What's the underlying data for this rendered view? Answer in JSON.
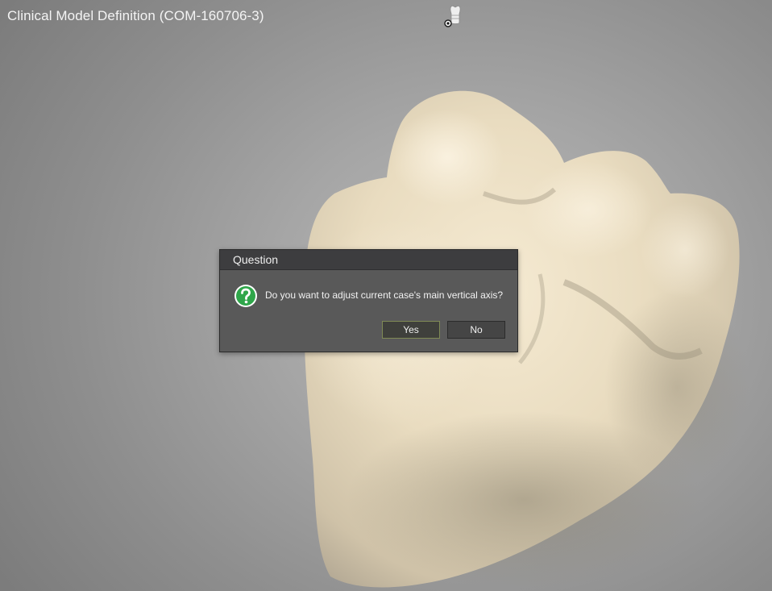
{
  "window": {
    "title": "Clinical Model Definition (COM-160706-3)"
  },
  "toolbar": {
    "view_icon": "tooth-eye-icon"
  },
  "dialog": {
    "title": "Question",
    "icon": "question-icon",
    "message": "Do you want to adjust current case's main vertical axis?",
    "buttons": {
      "yes_label": "Yes",
      "no_label": "No"
    }
  },
  "colors": {
    "dialog_title_bg": "#3d3d3f",
    "dialog_bg": "#595959",
    "question_icon": "#2fa64a",
    "model_fill": "#e8dcc2"
  }
}
